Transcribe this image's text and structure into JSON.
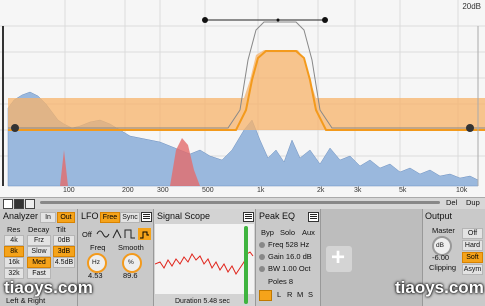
{
  "display": {
    "db_label": "20dB",
    "freq_ticks": [
      "100",
      "200",
      "300",
      "500",
      "1k",
      "2k",
      "3k",
      "5k",
      "10k"
    ],
    "right_buttons": [
      "Del",
      "Dup"
    ]
  },
  "analyzer": {
    "title": "Analyzer",
    "in_label": "In",
    "out_label": "Out",
    "col_heads": [
      "Res",
      "Decay",
      "Tilt"
    ],
    "res_options": [
      "4k",
      "8k",
      "16k",
      "32k"
    ],
    "decay_options": [
      "Frz",
      "Slow",
      "Med",
      "Fast"
    ],
    "tilt_options": [
      "0dB",
      "3dB",
      "4.5dB"
    ],
    "channel": "Left & Right"
  },
  "lfo": {
    "title": "LFO",
    "free_label": "Free",
    "sync_label": "Sync",
    "off_label": "Off",
    "freq_label": "Freq",
    "freq_unit": "Hz",
    "freq_value": "4.53",
    "smooth_label": "Smooth",
    "smooth_unit": "%",
    "smooth_value": "89.6"
  },
  "scope": {
    "title": "Signal Scope",
    "duration": "Duration 5.48 sec"
  },
  "peak_eq": {
    "title": "Peak EQ",
    "tabs": [
      "Byp",
      "Solo",
      "Aux"
    ],
    "freq": "Freq 528 Hz",
    "gain": "Gain 16.0 dB",
    "bw": "BW 1.00 Oct",
    "poles": "Poles 8",
    "channels": [
      "L",
      "R",
      "M",
      "S"
    ],
    "add_symbol": "+"
  },
  "output": {
    "title": "Output",
    "master_label": "Master",
    "master_unit": "dB",
    "master_value": "-6.00",
    "clip_label": "Clipping",
    "clip_options": [
      "Off",
      "Hard",
      "Soft",
      "Asym"
    ]
  },
  "watermarks": [
    "tiaoys.com",
    "tiaoys.com"
  ],
  "colors": {
    "accent": "#f5a31a",
    "spectrum_blue": "#9ab8dd",
    "scope_red": "#e0241b",
    "node_green": "#3fb43f"
  }
}
